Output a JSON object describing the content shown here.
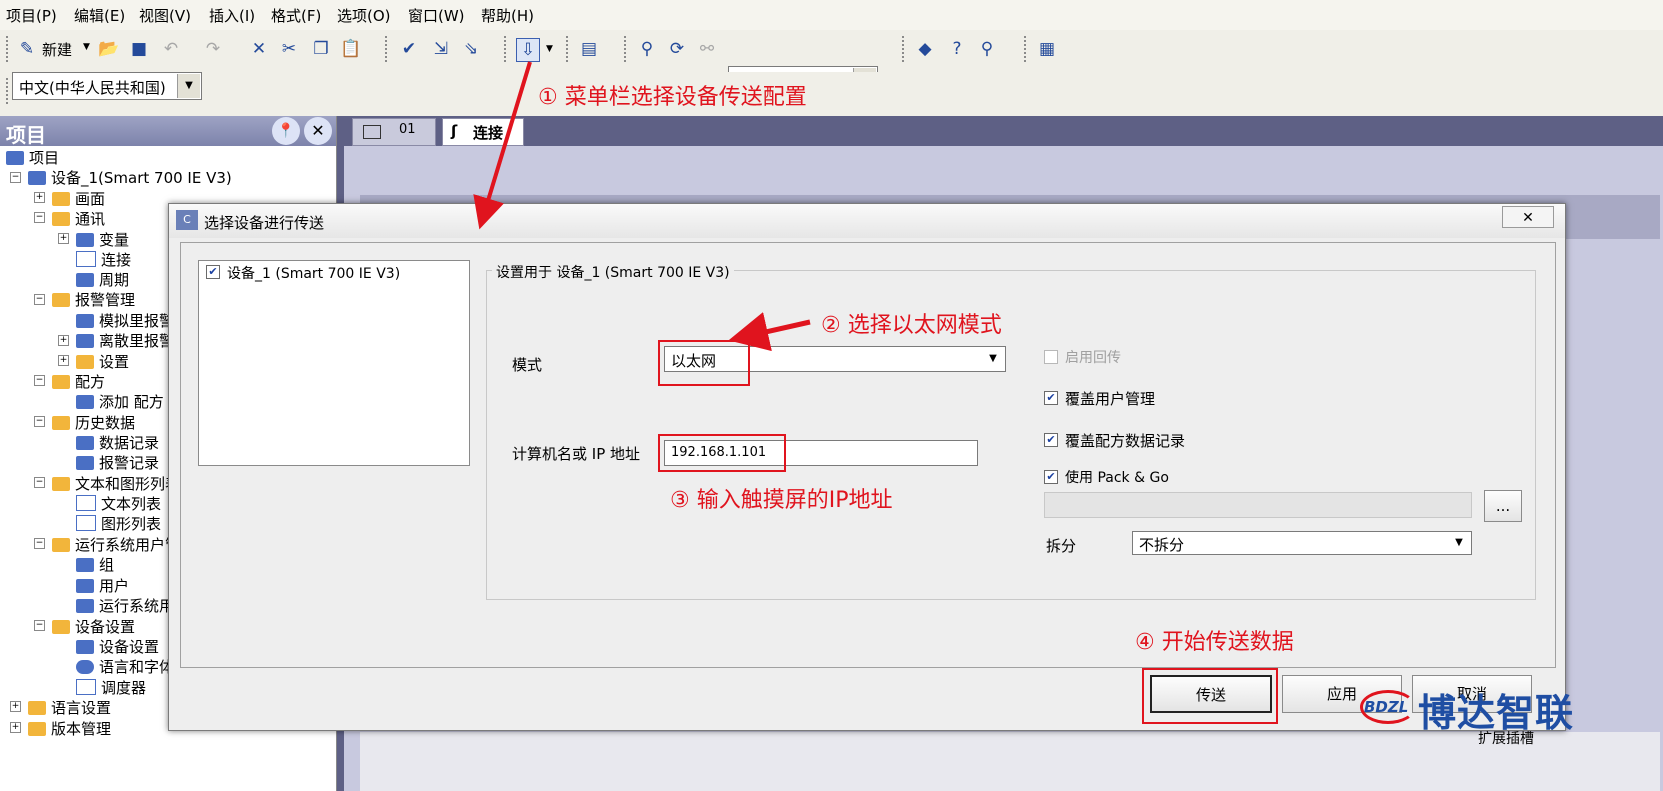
{
  "menubar": [
    "项目(P)",
    "编辑(E)",
    "视图(V)",
    "插入(I)",
    "格式(F)",
    "选项(O)",
    "窗口(W)",
    "帮助(H)"
  ],
  "toolbar": {
    "new_label": "新建",
    "search_value": ""
  },
  "language_combo": {
    "value": "中文(中华人民共和国)"
  },
  "project_panel": {
    "title": "项目",
    "tree": [
      "项目",
      "设备_1(Smart 700 IE V3)",
      "画面",
      "通讯",
      "变量",
      "连接",
      "周期",
      "报警管理",
      "模拟里报警",
      "离散里报警",
      "设置",
      "配方",
      "添加 配方",
      "历史数据",
      "数据记录",
      "报警记录",
      "文本和图形列表",
      "文本列表",
      "图形列表",
      "运行系统用户管理",
      "组",
      "用户",
      "运行系统用户",
      "设备设置",
      "设备设置",
      "语言和字体",
      "调度器",
      "语言设置",
      "版本管理"
    ]
  },
  "editor_tabs": [
    "01",
    "连接"
  ],
  "dialog": {
    "title": "选择设备进行传送",
    "close": "✕",
    "device_item": "设备_1 (Smart 700 IE V3)",
    "group_title": "设置用于 设备_1 (Smart 700 IE V3)",
    "mode_label": "模式",
    "mode_value": "以太网",
    "ip_label": "计算机名或 IP 地址",
    "ip_value": "192.168.1.101",
    "enable_backtransfer": "启用回传",
    "overwrite_users": "覆盖用户管理",
    "overwrite_recipes": "覆盖配方数据记录",
    "use_pack_go": "使用 Pack & Go",
    "browse": "...",
    "split_label": "拆分",
    "split_value": "不拆分",
    "transfer_button": "传送",
    "apply_button": "应用",
    "cancel_button": "取消"
  },
  "annotations": {
    "step1": "① 菜单栏选择设备传送配置",
    "step2": "② 选择以太网模式",
    "step3": "③ 输入触摸屏的IP地址",
    "step4": "④ 开始传送数据"
  },
  "logo": {
    "mark": "BDZL",
    "name": "博达智联"
  },
  "statusbar": {
    "bottom_text": "扩展插槽"
  },
  "colors": {
    "annotation_red": "#e0141e",
    "logo_blue": "#1f4ea3",
    "panel_header": "#7d83ab"
  }
}
